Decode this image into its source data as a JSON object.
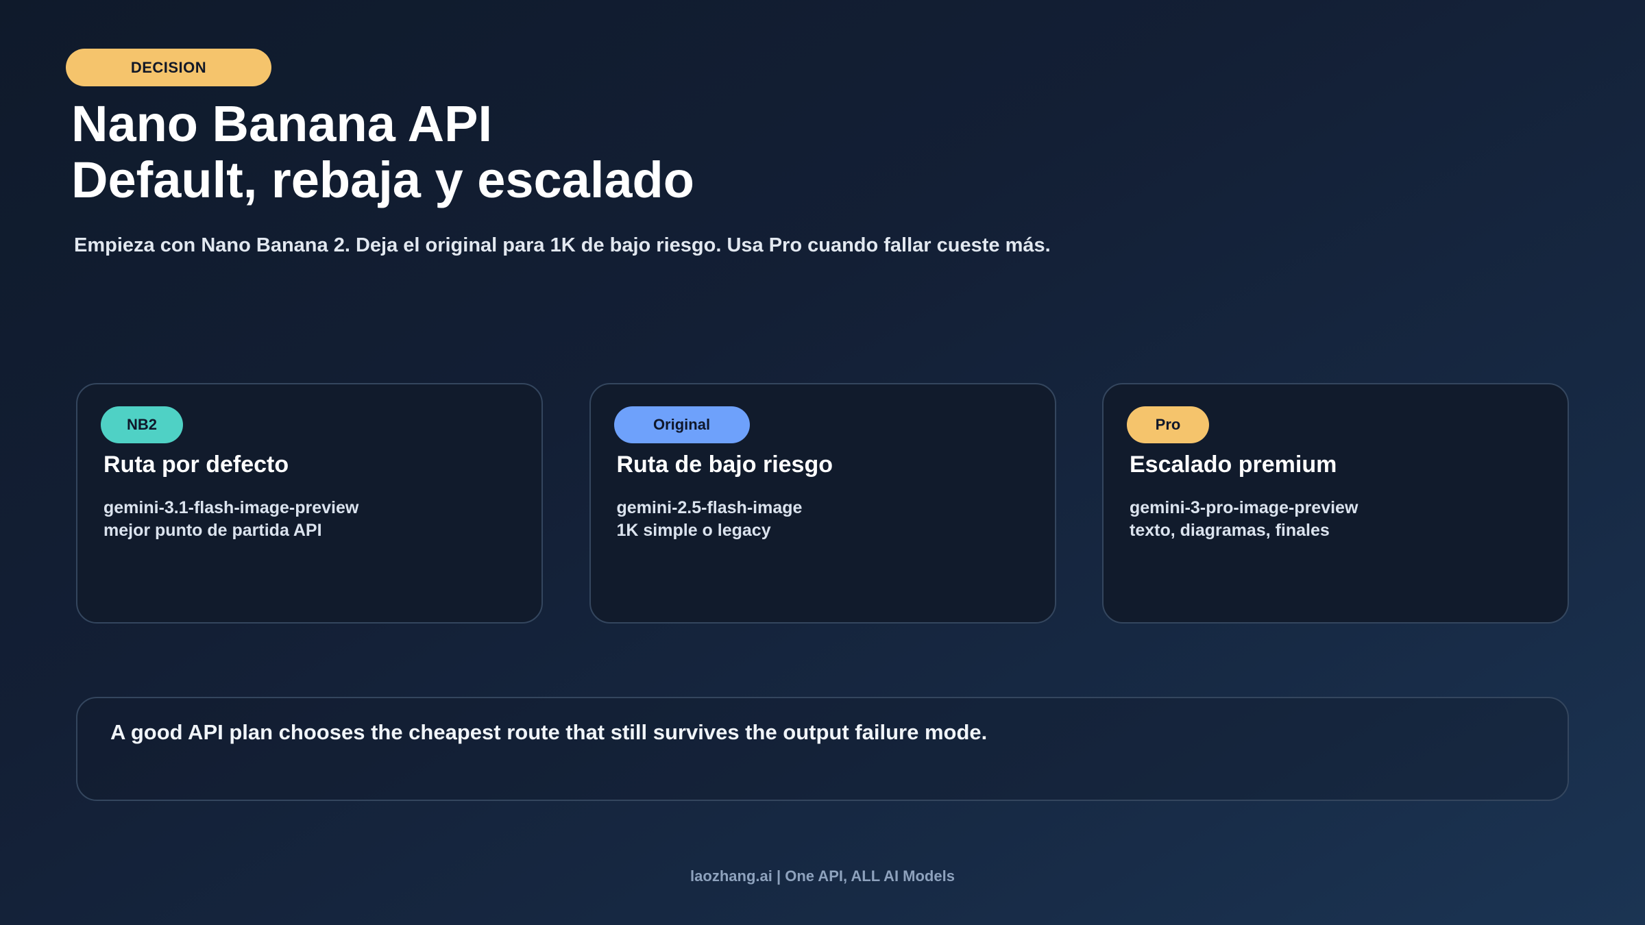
{
  "badge": "DECISION",
  "title_line1": "Nano Banana API",
  "title_line2": "Default, rebaja y escalado",
  "subtitle": "Empieza con Nano Banana 2. Deja el original para 1K de bajo riesgo. Usa Pro cuando fallar cueste más.",
  "cards": [
    {
      "tag": "NB2",
      "tag_color": "#4fd1c5",
      "title": "Ruta por defecto",
      "line1": "gemini-3.1-flash-image-preview",
      "line2": "mejor punto de partida API"
    },
    {
      "tag": "Original",
      "tag_color": "#6ea1fb",
      "title": "Ruta de bajo riesgo",
      "line1": "gemini-2.5-flash-image",
      "line2": "1K simple o legacy"
    },
    {
      "tag": "Pro",
      "tag_color": "#f5c46c",
      "title": "Escalado premium",
      "line1": "gemini-3-pro-image-preview",
      "line2": "texto, diagramas, finales"
    }
  ],
  "note": "A good API plan chooses the cheapest route that still survives the output failure mode.",
  "footer": "laozhang.ai | One API, ALL AI Models"
}
